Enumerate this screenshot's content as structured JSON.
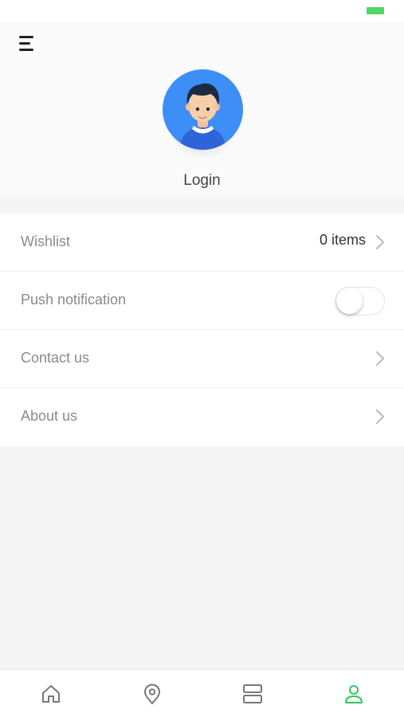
{
  "status_bar": {
    "battery_color": "#4cd964"
  },
  "header": {
    "menu_icon": "hamburger-menu-icon",
    "avatar_icon": "user-avatar-icon",
    "login_label": "Login"
  },
  "menu_list": {
    "items": [
      {
        "label": "Wishlist",
        "value": "0 items",
        "trailing": "chevron-right-icon"
      },
      {
        "label": "Push notification",
        "toggle_on": false
      },
      {
        "label": "Contact us",
        "trailing": "chevron-right-icon"
      },
      {
        "label": "About us",
        "trailing": "chevron-right-icon"
      }
    ]
  },
  "tab_bar": {
    "active_color": "#2ec760",
    "inactive_color": "#777777",
    "tabs": [
      {
        "icon": "home-icon",
        "active": false
      },
      {
        "icon": "location-pin-icon",
        "active": false
      },
      {
        "icon": "list-layout-icon",
        "active": false
      },
      {
        "icon": "profile-icon",
        "active": true
      }
    ]
  }
}
